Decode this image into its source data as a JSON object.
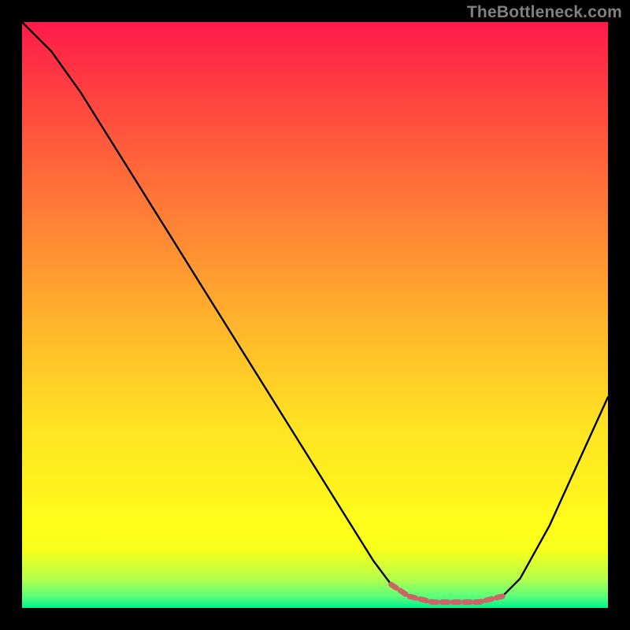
{
  "watermark": "TheBottleneck.com",
  "chart_data": {
    "type": "line",
    "x": [
      0.0,
      0.05,
      0.1,
      0.15,
      0.2,
      0.25,
      0.3,
      0.35,
      0.4,
      0.45,
      0.5,
      0.55,
      0.6,
      0.63,
      0.66,
      0.7,
      0.74,
      0.78,
      0.82,
      0.85,
      0.9,
      0.95,
      1.0
    ],
    "y": [
      1.0,
      0.95,
      0.88,
      0.8,
      0.72,
      0.64,
      0.56,
      0.48,
      0.4,
      0.32,
      0.24,
      0.16,
      0.08,
      0.04,
      0.02,
      0.01,
      0.01,
      0.01,
      0.02,
      0.05,
      0.14,
      0.25,
      0.36
    ],
    "series": [
      {
        "name": "bottleneck-curve",
        "color": "#000000",
        "x": [
          0.0,
          0.05,
          0.1,
          0.15,
          0.2,
          0.25,
          0.3,
          0.35,
          0.4,
          0.45,
          0.5,
          0.55,
          0.6,
          0.63,
          0.66,
          0.7,
          0.74,
          0.78,
          0.82,
          0.85,
          0.9,
          0.95,
          1.0
        ],
        "y": [
          1.0,
          0.95,
          0.88,
          0.8,
          0.72,
          0.64,
          0.56,
          0.48,
          0.4,
          0.32,
          0.24,
          0.16,
          0.08,
          0.04,
          0.02,
          0.01,
          0.01,
          0.01,
          0.02,
          0.05,
          0.14,
          0.25,
          0.36
        ]
      },
      {
        "name": "optimal-zone-marker",
        "color": "#cc6666",
        "x": [
          0.63,
          0.66,
          0.7,
          0.74,
          0.78,
          0.82
        ],
        "y": [
          0.04,
          0.02,
          0.01,
          0.01,
          0.01,
          0.02
        ]
      }
    ],
    "title": "",
    "xlabel": "",
    "ylabel": "",
    "xlim": [
      0,
      1
    ],
    "ylim": [
      0,
      1
    ],
    "gradient_stops": [
      {
        "pos": 0.0,
        "color": "#ff1a4a"
      },
      {
        "pos": 0.5,
        "color": "#ffb02c"
      },
      {
        "pos": 0.85,
        "color": "#fffe1a"
      },
      {
        "pos": 1.0,
        "color": "#00f08c"
      }
    ],
    "annotations": []
  }
}
